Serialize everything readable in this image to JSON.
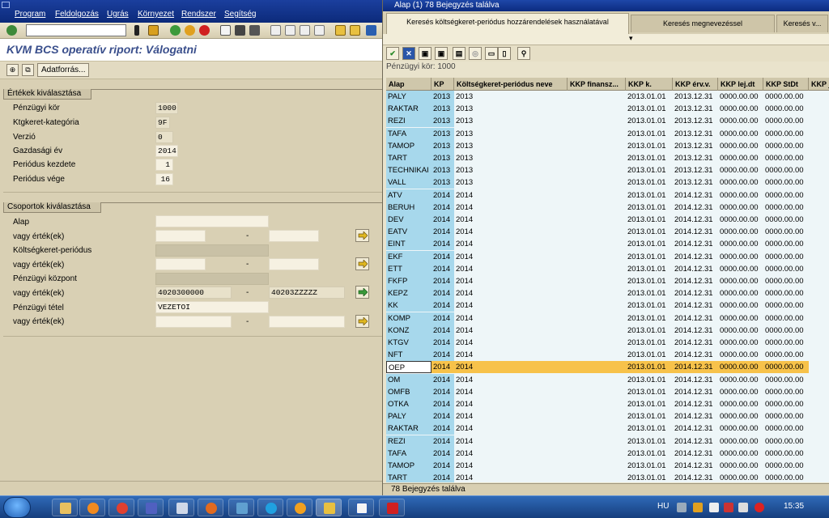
{
  "menubar": {
    "items": [
      "Program",
      "Feldolgozás",
      "Ugrás",
      "Környezet",
      "Rendszer",
      "Segítség"
    ]
  },
  "page": {
    "title": "KVM BCS operatív riport: Válogatni",
    "datasource_button": "Adatforrás..."
  },
  "values_frame": {
    "title": "Értékek kiválasztása",
    "fields": [
      {
        "label": "Pénzügyi kör",
        "value": "1000"
      },
      {
        "label": "Ktgkeret-kategória",
        "value": "9F"
      },
      {
        "label": "Verzió",
        "value": "0"
      },
      {
        "label": "Gazdasági év",
        "value": "2014"
      },
      {
        "label": "Periódus kezdete",
        "value": "1"
      },
      {
        "label": "Periódus vége",
        "value": "16"
      }
    ]
  },
  "groups_frame": {
    "title": "Csoportok kiválasztása",
    "or_values_label": "vagy érték(ek)",
    "groups": [
      {
        "label": "Alap",
        "from": "",
        "to": ""
      },
      {
        "label": "Költségkeret-periódus",
        "from": "",
        "to": ""
      },
      {
        "label": "Pénzügyi központ",
        "from": "4020300000",
        "to": "40203ZZZZZ"
      },
      {
        "label": "Pénzügyi tétel",
        "from": "VEZETOI",
        "to": ""
      }
    ]
  },
  "popup": {
    "title": "Alap (1)  78 Bejegyzés találva",
    "tabs": [
      "Keresés költségkeret-periódus hozzárendelések használatával",
      "Keresés megnevezéssel",
      "Keresés v..."
    ],
    "info_line": "Pénzügyi kör: 1000",
    "columns": [
      "Alap",
      "KP",
      "Költségkeret-periódus neve",
      "KKP finansz...",
      "KKP k.",
      "KKP érv.v.",
      "KKP lej.dt",
      "KKP StDt",
      "KKP je"
    ],
    "rows": [
      [
        "PALY",
        "2013",
        "2013",
        "",
        "2013.01.01",
        "2013.12.31",
        "0000.00.00",
        "0000.00.00"
      ],
      [
        "RAKTAR",
        "2013",
        "2013",
        "",
        "2013.01.01",
        "2013.12.31",
        "0000.00.00",
        "0000.00.00"
      ],
      [
        "REZI",
        "2013",
        "2013",
        "",
        "2013.01.01",
        "2013.12.31",
        "0000.00.00",
        "0000.00.00"
      ],
      [
        "TAFA",
        "2013",
        "2013",
        "",
        "2013.01.01",
        "2013.12.31",
        "0000.00.00",
        "0000.00.00"
      ],
      [
        "TAMOP",
        "2013",
        "2013",
        "",
        "2013.01.01",
        "2013.12.31",
        "0000.00.00",
        "0000.00.00"
      ],
      [
        "TART",
        "2013",
        "2013",
        "",
        "2013.01.01",
        "2013.12.31",
        "0000.00.00",
        "0000.00.00"
      ],
      [
        "TECHNIKAI",
        "2013",
        "2013",
        "",
        "2013.01.01",
        "2013.12.31",
        "0000.00.00",
        "0000.00.00"
      ],
      [
        "VALL",
        "2013",
        "2013",
        "",
        "2013.01.01",
        "2013.12.31",
        "0000.00.00",
        "0000.00.00"
      ],
      [
        "ATV",
        "2014",
        "2014",
        "",
        "2013.01.01",
        "2014.12.31",
        "0000.00.00",
        "0000.00.00"
      ],
      [
        "BERUH",
        "2014",
        "2014",
        "",
        "2013.01.01",
        "2014.12.31",
        "0000.00.00",
        "0000.00.00"
      ],
      [
        "DEV",
        "2014",
        "2014",
        "",
        "2013.01.01",
        "2014.12.31",
        "0000.00.00",
        "0000.00.00"
      ],
      [
        "EATV",
        "2014",
        "2014",
        "",
        "2013.01.01",
        "2014.12.31",
        "0000.00.00",
        "0000.00.00"
      ],
      [
        "EINT",
        "2014",
        "2014",
        "",
        "2013.01.01",
        "2014.12.31",
        "0000.00.00",
        "0000.00.00"
      ],
      [
        "EKF",
        "2014",
        "2014",
        "",
        "2013.01.01",
        "2014.12.31",
        "0000.00.00",
        "0000.00.00"
      ],
      [
        "ETT",
        "2014",
        "2014",
        "",
        "2013.01.01",
        "2014.12.31",
        "0000.00.00",
        "0000.00.00"
      ],
      [
        "FKFP",
        "2014",
        "2014",
        "",
        "2013.01.01",
        "2014.12.31",
        "0000.00.00",
        "0000.00.00"
      ],
      [
        "KEPZ",
        "2014",
        "2014",
        "",
        "2013.01.01",
        "2014.12.31",
        "0000.00.00",
        "0000.00.00"
      ],
      [
        "KK",
        "2014",
        "2014",
        "",
        "2013.01.01",
        "2014.12.31",
        "0000.00.00",
        "0000.00.00"
      ],
      [
        "KOMP",
        "2014",
        "2014",
        "",
        "2013.01.01",
        "2014.12.31",
        "0000.00.00",
        "0000.00.00"
      ],
      [
        "KONZ",
        "2014",
        "2014",
        "",
        "2013.01.01",
        "2014.12.31",
        "0000.00.00",
        "0000.00.00"
      ],
      [
        "KTGV",
        "2014",
        "2014",
        "",
        "2013.01.01",
        "2014.12.31",
        "0000.00.00",
        "0000.00.00"
      ],
      [
        "NFT",
        "2014",
        "2014",
        "",
        "2013.01.01",
        "2014.12.31",
        "0000.00.00",
        "0000.00.00"
      ],
      [
        "OEP",
        "2014",
        "2014",
        "",
        "2013.01.01",
        "2014.12.31",
        "0000.00.00",
        "0000.00.00"
      ],
      [
        "OM",
        "2014",
        "2014",
        "",
        "2013.01.01",
        "2014.12.31",
        "0000.00.00",
        "0000.00.00"
      ],
      [
        "OMFB",
        "2014",
        "2014",
        "",
        "2013.01.01",
        "2014.12.31",
        "0000.00.00",
        "0000.00.00"
      ],
      [
        "OTKA",
        "2014",
        "2014",
        "",
        "2013.01.01",
        "2014.12.31",
        "0000.00.00",
        "0000.00.00"
      ],
      [
        "PALY",
        "2014",
        "2014",
        "",
        "2013.01.01",
        "2014.12.31",
        "0000.00.00",
        "0000.00.00"
      ],
      [
        "RAKTAR",
        "2014",
        "2014",
        "",
        "2013.01.01",
        "2014.12.31",
        "0000.00.00",
        "0000.00.00"
      ],
      [
        "REZI",
        "2014",
        "2014",
        "",
        "2013.01.01",
        "2014.12.31",
        "0000.00.00",
        "0000.00.00"
      ],
      [
        "TAFA",
        "2014",
        "2014",
        "",
        "2013.01.01",
        "2014.12.31",
        "0000.00.00",
        "0000.00.00"
      ],
      [
        "TAMOP",
        "2014",
        "2014",
        "",
        "2013.01.01",
        "2014.12.31",
        "0000.00.00",
        "0000.00.00"
      ],
      [
        "TART",
        "2014",
        "2014",
        "",
        "2013.01.01",
        "2014.12.31",
        "0000.00.00",
        "0000.00.00"
      ]
    ],
    "selected_row": "OEP",
    "status": "78 Bejegyzés találva"
  },
  "taskbar": {
    "language": "HU",
    "clock": "15:35"
  },
  "colors": {
    "sap_blue": "#0c2a7a",
    "title_text": "#3a4f8c",
    "key_column": "#a7d8ec",
    "selected_row": "#f7c24a"
  },
  "icons": {
    "toolbar": [
      "enter-icon",
      "save-icon",
      "back-icon",
      "exit-icon",
      "cancel-icon",
      "print-icon",
      "find-icon",
      "find-next-icon",
      "first-page-icon",
      "previous-page-icon",
      "next-page-icon",
      "last-page-icon",
      "new-session-icon",
      "shortcut-icon"
    ],
    "popup_toolbar": [
      "accept-icon",
      "cancel-icon",
      "find-icon",
      "find-next-icon",
      "restrict-icon",
      "settings-icon",
      "info-icon",
      "print-icon",
      "new-selection-icon"
    ]
  }
}
